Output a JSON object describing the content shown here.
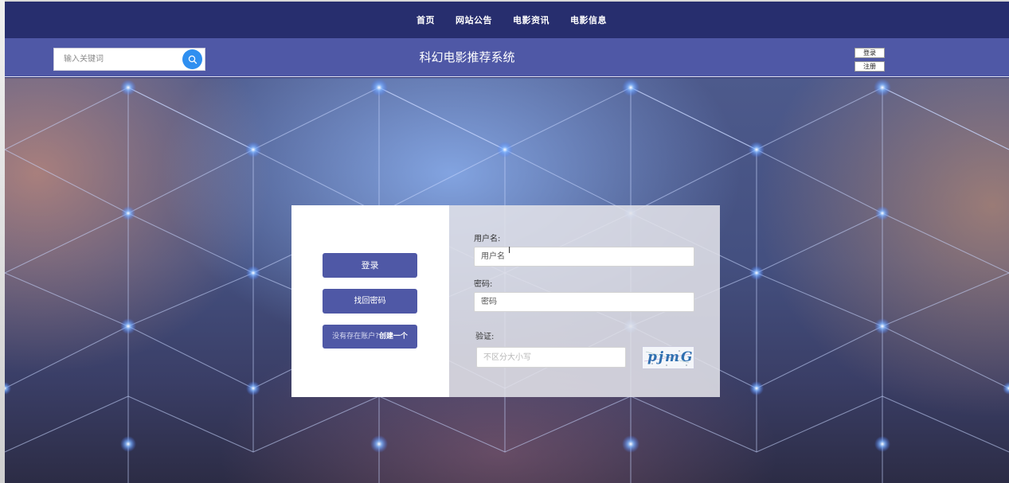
{
  "nav": {
    "items": [
      "首页",
      "网站公告",
      "电影资讯",
      "电影信息"
    ]
  },
  "header": {
    "search_placeholder": "输入关键词",
    "title": "科幻电影推荐系统",
    "login_label": "登录",
    "register_label": "注册"
  },
  "login": {
    "login_button": "登录",
    "forgot_button": "找回密码",
    "create_prefix": "没有存在账户?",
    "create_link": "创建一个",
    "username_label": "用户名:",
    "username_placeholder": "用户名",
    "password_label": "密码:",
    "password_placeholder": "密码",
    "captcha_label": "验证:",
    "captcha_placeholder": "不区分大小写",
    "captcha_text": "pjmG"
  },
  "colors": {
    "nav_bg": "#272e6e",
    "header_bg": "#4f58a6",
    "button_bg": "#4f58a6",
    "search_button": "#2f8ff0"
  },
  "icons": {
    "search": "search-icon"
  }
}
